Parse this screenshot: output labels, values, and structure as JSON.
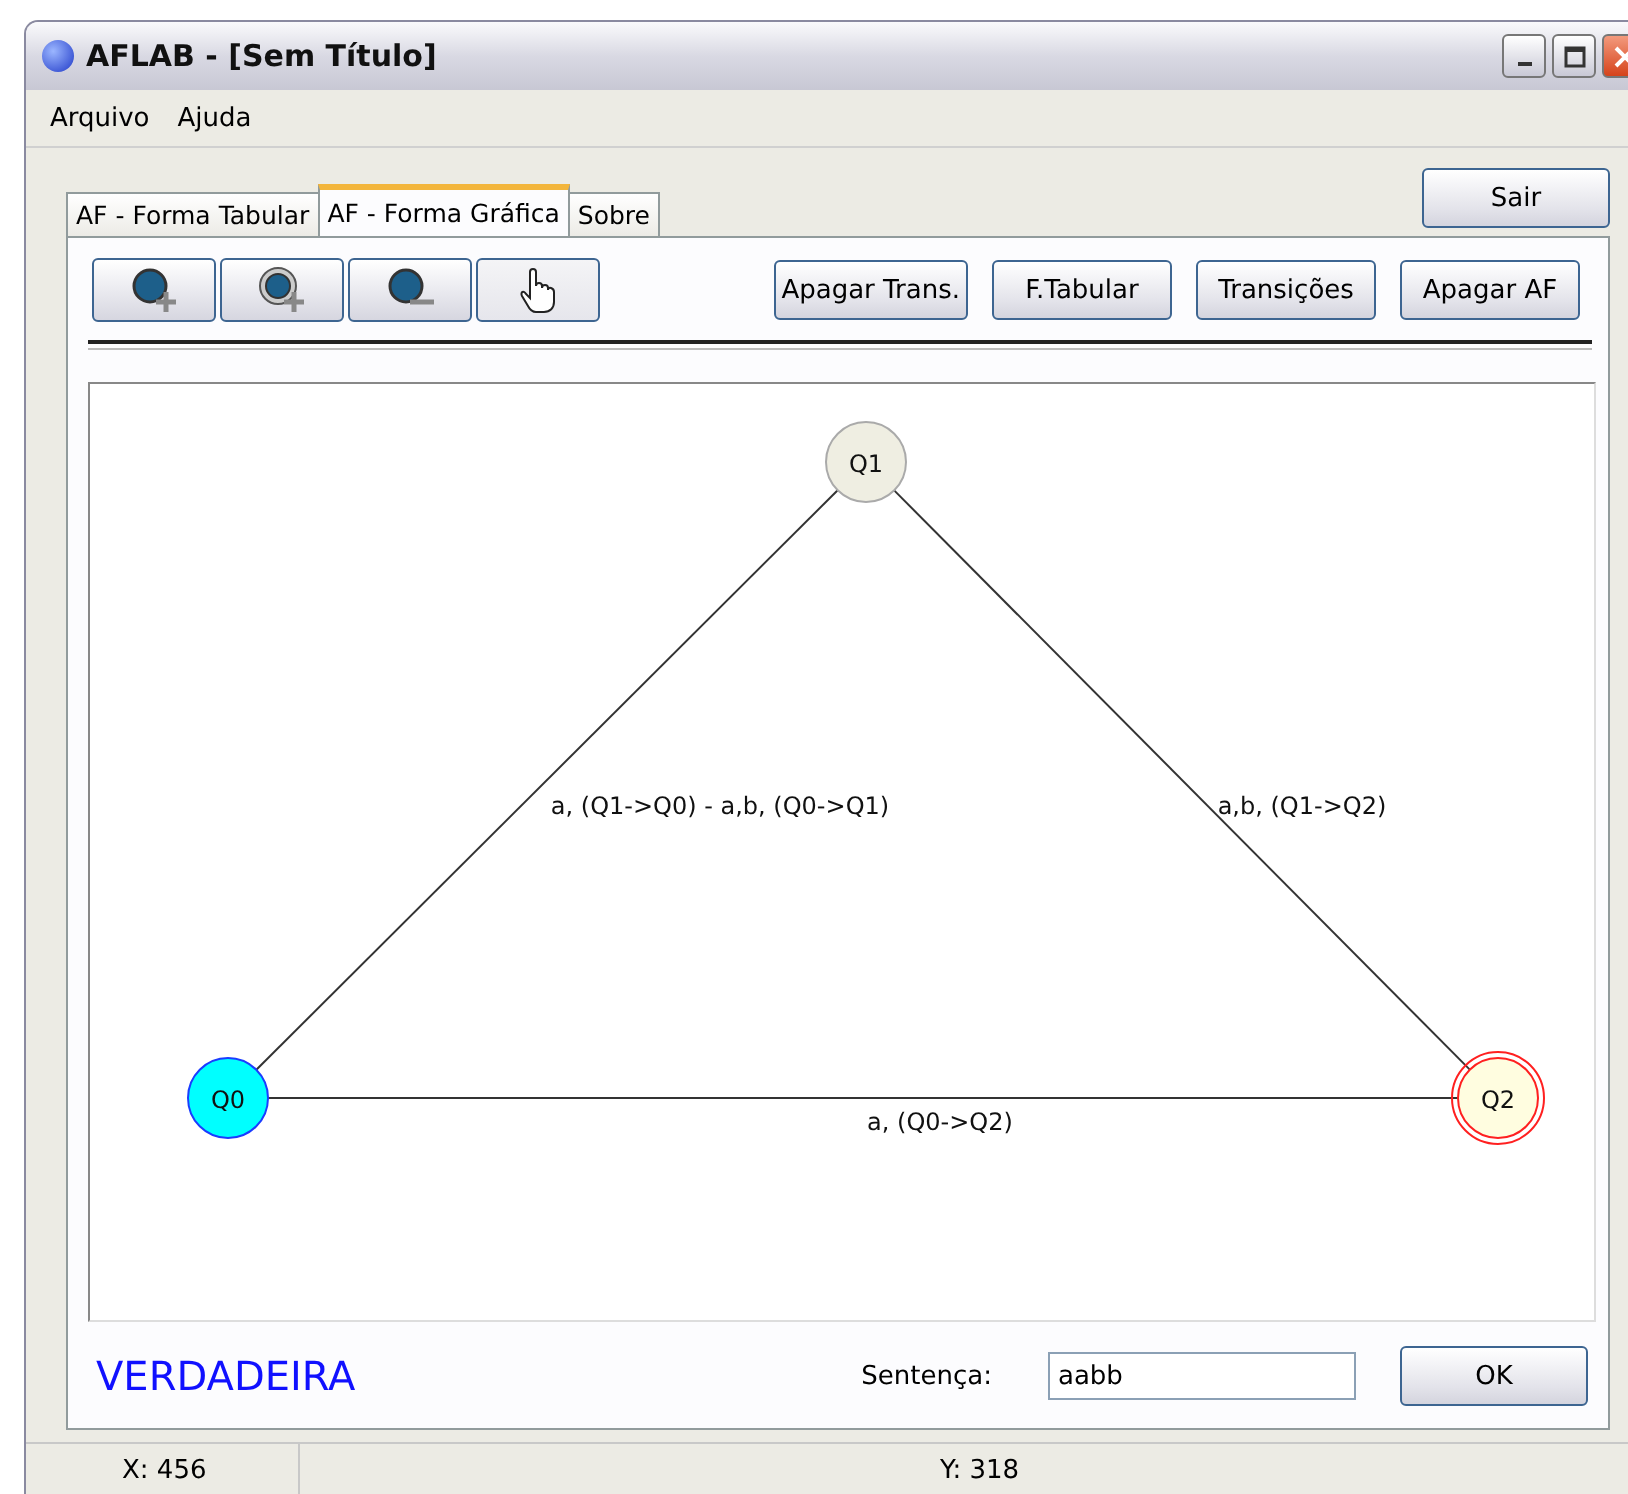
{
  "window": {
    "title": "AFLAB - [Sem Título]"
  },
  "menu": [
    "Arquivo",
    "Ajuda"
  ],
  "tabs": [
    {
      "label": "AF - Forma Tabular",
      "selected": false
    },
    {
      "label": "AF - Forma Gráfica",
      "selected": true
    },
    {
      "label": "Sobre",
      "selected": false
    }
  ],
  "exit_button": "Sair",
  "tools": [
    {
      "kind": "add_state",
      "selected": false
    },
    {
      "kind": "add_final",
      "selected": false
    },
    {
      "kind": "remove_state",
      "selected": false
    },
    {
      "kind": "move",
      "selected": true
    }
  ],
  "actions": [
    "Apagar Trans.",
    "F.Tabular",
    "Transições",
    "Apagar AF"
  ],
  "states": [
    {
      "name": "Q1",
      "kind": "normal"
    },
    {
      "name": "Q0",
      "kind": "initial"
    },
    {
      "name": "Q2",
      "kind": "final"
    }
  ],
  "transitions": [
    {
      "label": "a, (Q1->Q0) - a,b, (Q0->Q1)"
    },
    {
      "label": "a,b, (Q1->Q2)"
    },
    {
      "label": "a, (Q0->Q2)"
    }
  ],
  "result": "VERDADEIRA",
  "sentence": {
    "label": "Sentença:",
    "value": "aabb"
  },
  "ok_button": "OK",
  "status_bar": [
    "X: 456",
    "Y: 318"
  ]
}
